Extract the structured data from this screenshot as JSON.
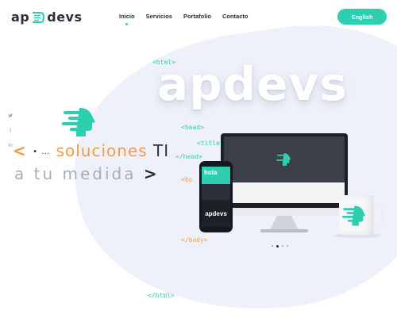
{
  "logo": {
    "text_left": "ap",
    "text_right": "devs"
  },
  "nav": {
    "items": [
      "Inicio",
      "Servicios",
      "Portafolio",
      "Contacto"
    ]
  },
  "language_button": "English",
  "social": {
    "icons": [
      "twitter-icon",
      "facebook-icon",
      "linkedin-icon"
    ],
    "glyphs": [
      "🐦",
      "f",
      "in"
    ]
  },
  "code_tags": {
    "html_open": "<html>",
    "head_open": "<head>",
    "title": "<title",
    "head_close": "</head>",
    "body": "<bo",
    "body_close": "</body>",
    "html_close": "</html>"
  },
  "hero": {
    "brand": "apdevs",
    "slogan_lt": "<",
    "slogan_dots": "• …",
    "slogan_word": "soluciones",
    "slogan_ti": "TI",
    "slogan_line2": "a tu medida",
    "slogan_gt": ">"
  },
  "mockups": {
    "phone_greeting": "hola",
    "phone_brand": "apdevs"
  },
  "colors": {
    "accent": "#2ecfb1",
    "orange": "#f49a4c",
    "dark": "#2a2f3a",
    "muted": "#a6aeb9"
  }
}
